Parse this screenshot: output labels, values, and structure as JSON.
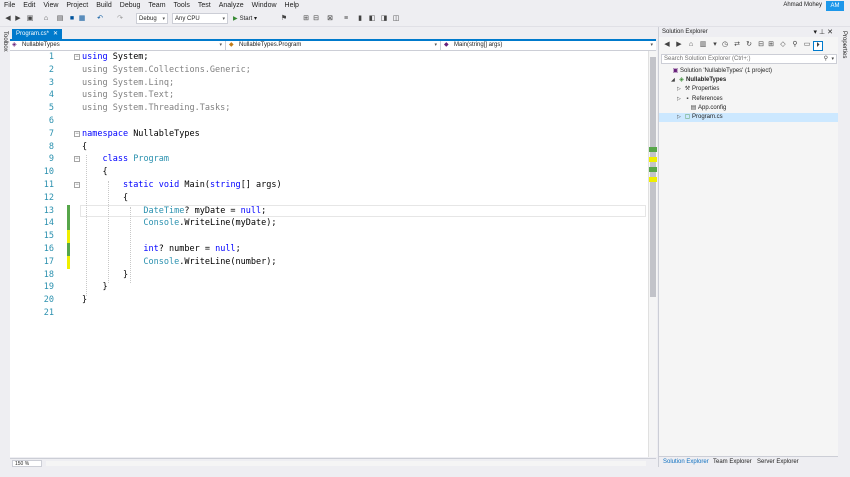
{
  "menu": [
    "File",
    "Edit",
    "View",
    "Project",
    "Build",
    "Debug",
    "Team",
    "Tools",
    "Test",
    "Analyze",
    "Window",
    "Help"
  ],
  "user": {
    "name": "Ahmad Mohey",
    "initials": "AM"
  },
  "toolbar": {
    "config": "Debug",
    "platform": "Any CPU",
    "start_label": "Start"
  },
  "side": {
    "toolbox": "Toolbox",
    "properties": "Properties"
  },
  "editor": {
    "tab": "Program.cs*",
    "nav": {
      "project": "NullableTypes",
      "class": "NullableTypes.Program",
      "member": "Main(string[] args)"
    },
    "zoom": "150 %",
    "lines": [
      {
        "n": "1",
        "parts": [
          {
            "t": "using ",
            "c": "kw"
          },
          {
            "t": "System;",
            "c": "pl"
          }
        ]
      },
      {
        "n": "2",
        "parts": [
          {
            "t": "using System.Collections.Generic;",
            "c": "fade"
          }
        ]
      },
      {
        "n": "3",
        "parts": [
          {
            "t": "using System.Linq;",
            "c": "fade"
          }
        ]
      },
      {
        "n": "4",
        "parts": [
          {
            "t": "using System.Text;",
            "c": "fade"
          }
        ]
      },
      {
        "n": "5",
        "parts": [
          {
            "t": "using System.Threading.Tasks;",
            "c": "fade"
          }
        ]
      },
      {
        "n": "6",
        "parts": []
      },
      {
        "n": "7",
        "parts": [
          {
            "t": "namespace ",
            "c": "kw"
          },
          {
            "t": "NullableTypes",
            "c": "pl"
          }
        ]
      },
      {
        "n": "8",
        "parts": [
          {
            "t": "{",
            "c": "pl"
          }
        ]
      },
      {
        "n": "9",
        "parts": [
          {
            "t": "    ",
            "c": "pl"
          },
          {
            "t": "class ",
            "c": "kw"
          },
          {
            "t": "Program",
            "c": "ty"
          }
        ]
      },
      {
        "n": "10",
        "parts": [
          {
            "t": "    {",
            "c": "pl"
          }
        ]
      },
      {
        "n": "11",
        "parts": [
          {
            "t": "        ",
            "c": "pl"
          },
          {
            "t": "static void ",
            "c": "kw"
          },
          {
            "t": "Main(",
            "c": "pl"
          },
          {
            "t": "string",
            "c": "kw"
          },
          {
            "t": "[] args)",
            "c": "pl"
          }
        ]
      },
      {
        "n": "12",
        "parts": [
          {
            "t": "        {",
            "c": "pl"
          }
        ]
      },
      {
        "n": "13",
        "parts": [
          {
            "t": "            ",
            "c": "pl"
          },
          {
            "t": "DateTime",
            "c": "ty"
          },
          {
            "t": "? myDate = ",
            "c": "pl"
          },
          {
            "t": "null",
            "c": "kw"
          },
          {
            "t": ";",
            "c": "pl"
          }
        ]
      },
      {
        "n": "14",
        "parts": [
          {
            "t": "            ",
            "c": "pl"
          },
          {
            "t": "Console",
            "c": "ty"
          },
          {
            "t": ".WriteLine(myDate);",
            "c": "pl"
          }
        ]
      },
      {
        "n": "15",
        "parts": []
      },
      {
        "n": "16",
        "parts": [
          {
            "t": "            ",
            "c": "pl"
          },
          {
            "t": "int",
            "c": "kw"
          },
          {
            "t": "? number = ",
            "c": "pl"
          },
          {
            "t": "null",
            "c": "kw"
          },
          {
            "t": ";",
            "c": "pl"
          }
        ]
      },
      {
        "n": "17",
        "parts": [
          {
            "t": "            ",
            "c": "pl"
          },
          {
            "t": "Console",
            "c": "ty"
          },
          {
            "t": ".WriteLine(number);",
            "c": "pl"
          }
        ]
      },
      {
        "n": "18",
        "parts": [
          {
            "t": "        }",
            "c": "pl"
          }
        ]
      },
      {
        "n": "19",
        "parts": [
          {
            "t": "    }",
            "c": "pl"
          }
        ]
      },
      {
        "n": "20",
        "parts": [
          {
            "t": "}",
            "c": "pl"
          }
        ]
      },
      {
        "n": "21",
        "parts": []
      }
    ]
  },
  "solution_explorer": {
    "title": "Solution Explorer",
    "search_placeholder": "Search Solution Explorer (Ctrl+;)",
    "tree": [
      {
        "label": "Solution 'NullableTypes' (1 project)",
        "icon": "solution-icon"
      },
      {
        "label": "NullableTypes",
        "icon": "csharp-project-icon"
      },
      {
        "label": "Properties",
        "icon": "wrench-icon"
      },
      {
        "label": "References",
        "icon": "references-icon"
      },
      {
        "label": "App.config",
        "icon": "config-file-icon"
      },
      {
        "label": "Program.cs",
        "icon": "csharp-file-icon"
      }
    ],
    "tabs": [
      "Solution Explorer",
      "Team Explorer",
      "Server Explorer"
    ]
  }
}
